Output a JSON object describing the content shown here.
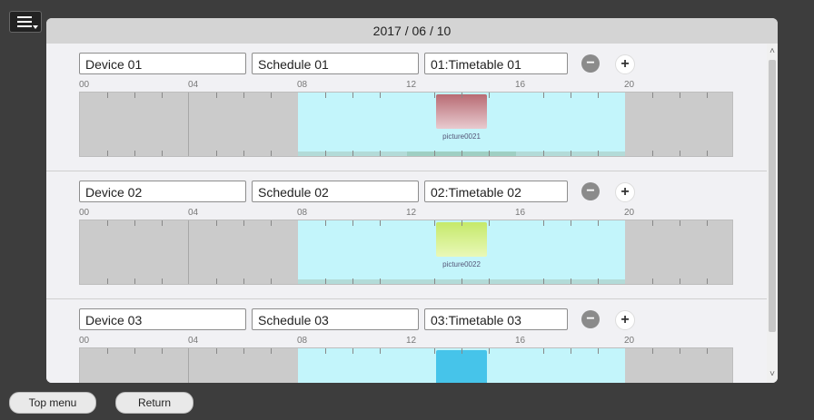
{
  "header": {
    "date": "2017 / 06 / 10"
  },
  "tick_labels": [
    "00",
    "04",
    "08",
    "12",
    "16",
    "20"
  ],
  "rows": [
    {
      "device": "Device 01",
      "schedule": "Schedule 01",
      "timetable": "01:Timetable 01",
      "picture": "picture0021",
      "picture_color": "#b86b73"
    },
    {
      "device": "Device 02",
      "schedule": "Schedule 02",
      "timetable": "02:Timetable 02",
      "picture": "picture0022",
      "picture_color": "#c5e96a"
    },
    {
      "device": "Device 03",
      "schedule": "Schedule 03",
      "timetable": "03:Timetable 03",
      "picture": "",
      "picture_color": "#46c4ea"
    }
  ],
  "buttons": {
    "minus": "−",
    "plus": "+"
  },
  "footer": {
    "top_menu": "Top menu",
    "return": "Return"
  },
  "colors": {
    "background": "#3d3d3d",
    "timeline_active": "#c3f5fb",
    "timeline_inactive": "#cbcbcb"
  }
}
